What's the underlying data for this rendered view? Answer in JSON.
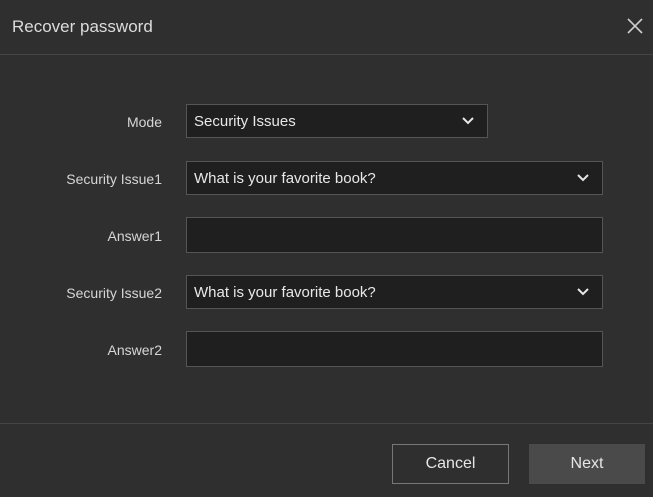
{
  "dialog": {
    "title": "Recover password",
    "close_icon": "close-icon"
  },
  "form": {
    "mode": {
      "label": "Mode",
      "value": "Security Issues"
    },
    "security_issue1": {
      "label": "Security Issue1",
      "value": "What is your favorite book?"
    },
    "answer1": {
      "label": "Answer1",
      "value": ""
    },
    "security_issue2": {
      "label": "Security Issue2",
      "value": "What is your favorite book?"
    },
    "answer2": {
      "label": "Answer2",
      "value": ""
    }
  },
  "footer": {
    "cancel_label": "Cancel",
    "next_label": "Next"
  },
  "colors": {
    "background": "#2f2f2f",
    "field_background": "#1f1f1f",
    "field_border": "#555555",
    "next_button": "#4a4a4a"
  }
}
